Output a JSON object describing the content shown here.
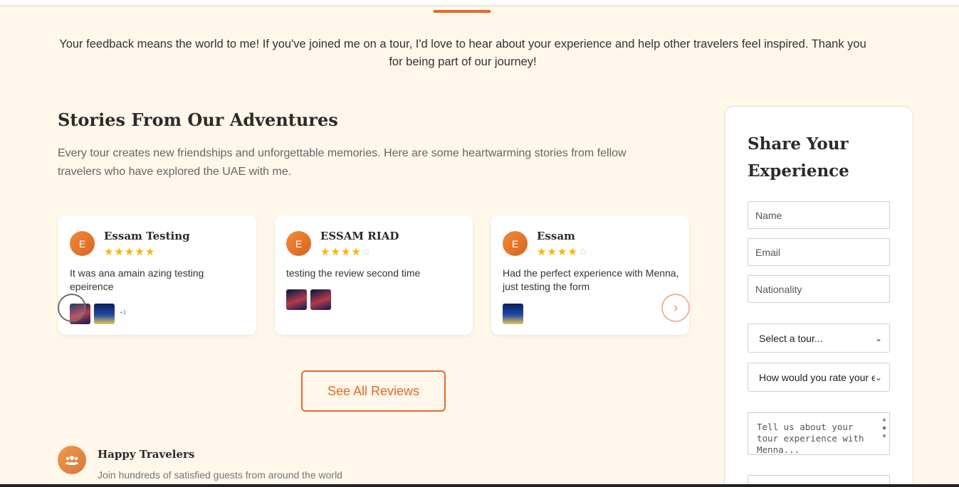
{
  "intro": {
    "text": "Your feedback means the world to me! If you've joined me on a tour, I'd love to hear about your experience and help other travelers feel inspired. Thank you for being part of our journey!"
  },
  "stories": {
    "title": "Stories From Our Adventures",
    "description": "Every tour creates new friendships and unforgettable memories. Here are some heartwarming stories from fellow travelers who have explored the UAE with me."
  },
  "reviews": [
    {
      "initial": "E",
      "name": "Essam Testing",
      "rating": 5,
      "text": "It was ana amain azing testing epeirence",
      "photos": [
        "night-city-photo",
        "city-skyline-photo"
      ],
      "more": "+1"
    },
    {
      "initial": "E",
      "name": "ESSAM RIAD",
      "rating": 4,
      "text": "testing the review second time",
      "photos": [
        "night-city-photo",
        "night-city-photo"
      ],
      "more": ""
    },
    {
      "initial": "E",
      "name": "Essam",
      "rating": 4,
      "text": "Had the perfect experience with Menna, just testing the form",
      "photos": [
        "city-skyline-photo"
      ],
      "more": ""
    }
  ],
  "carousel": {
    "prev_icon": "chevron-left-icon",
    "next_icon": "chevron-right-icon",
    "next_glyph": "›"
  },
  "see_all_label": "See All Reviews",
  "feature": {
    "icon": "users-icon",
    "title": "Happy Travelers",
    "description": "Join hundreds of satisfied guests from around the world"
  },
  "form": {
    "title": "Share Your Experience",
    "name_placeholder": "Name",
    "email_placeholder": "Email",
    "nationality_placeholder": "Nationality",
    "tour_select": "Select a tour...",
    "rating_select": "How would you rate your experience?",
    "message_placeholder": "Tell us about your tour experience with Menna..."
  },
  "colors": {
    "accent": "#e36a2a",
    "background": "#fef7ea",
    "star": "#f7b500"
  }
}
